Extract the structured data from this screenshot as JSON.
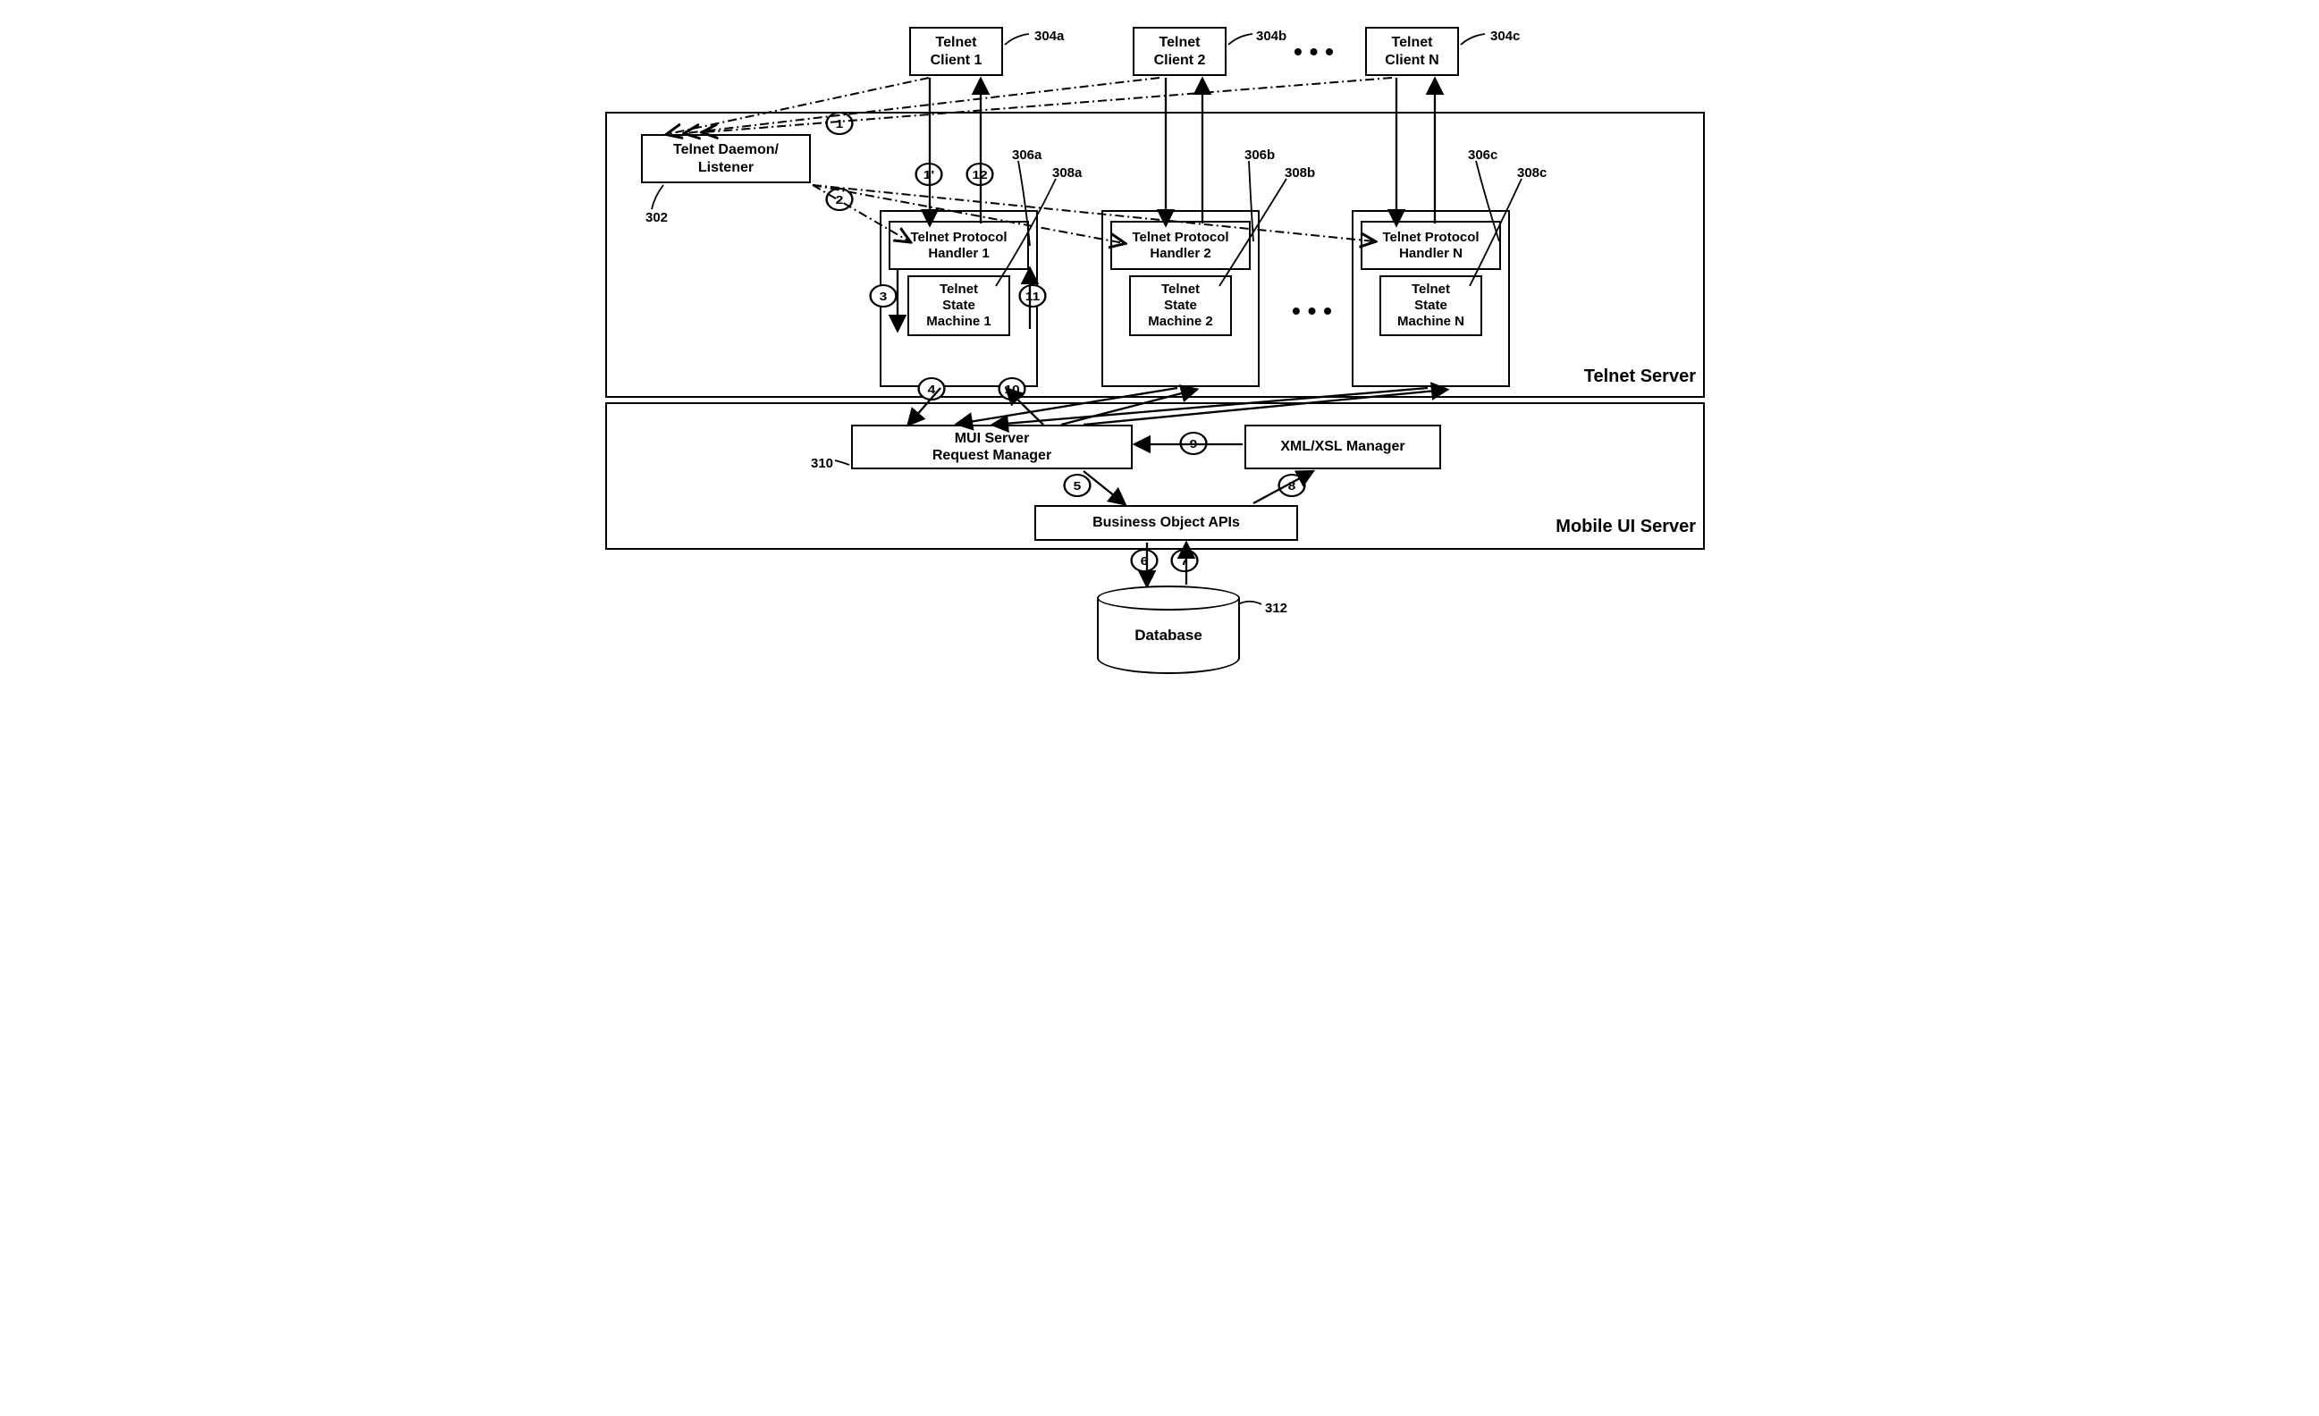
{
  "clients": [
    {
      "label": "Telnet\nClient 1",
      "ref": "304a"
    },
    {
      "label": "Telnet\nClient 2",
      "ref": "304b"
    },
    {
      "label": "Telnet\nClient N",
      "ref": "304c"
    }
  ],
  "daemon": {
    "label": "Telnet Daemon/\nListener",
    "ref": "302"
  },
  "handlers": [
    {
      "protocol": "Telnet Protocol\nHandler 1",
      "state": "Telnet\nState\nMachine 1",
      "protoRef": "306a",
      "stateRef": "308a"
    },
    {
      "protocol": "Telnet Protocol\nHandler 2",
      "state": "Telnet\nState\nMachine 2",
      "protoRef": "306b",
      "stateRef": "308b"
    },
    {
      "protocol": "Telnet Protocol\nHandler N",
      "state": "Telnet\nState\nMachine N",
      "protoRef": "306c",
      "stateRef": "308c"
    }
  ],
  "server_labels": {
    "telnet_server": "Telnet Server",
    "mobile_ui_server": "Mobile UI Server"
  },
  "mui": {
    "request_manager": "MUI Server\nRequest Manager",
    "request_manager_ref": "310",
    "xml_manager": "XML/XSL Manager",
    "business_apis": "Business Object APIs"
  },
  "database": {
    "label": "Database",
    "ref": "312"
  },
  "steps": {
    "s1": "1",
    "s1p": "1'",
    "s2": "2",
    "s3": "3",
    "s4": "4",
    "s5": "5",
    "s6": "6",
    "s7": "7",
    "s8": "8",
    "s9": "9",
    "s10": "10",
    "s11": "11",
    "s12": "12"
  },
  "ellipsis": "• • •"
}
